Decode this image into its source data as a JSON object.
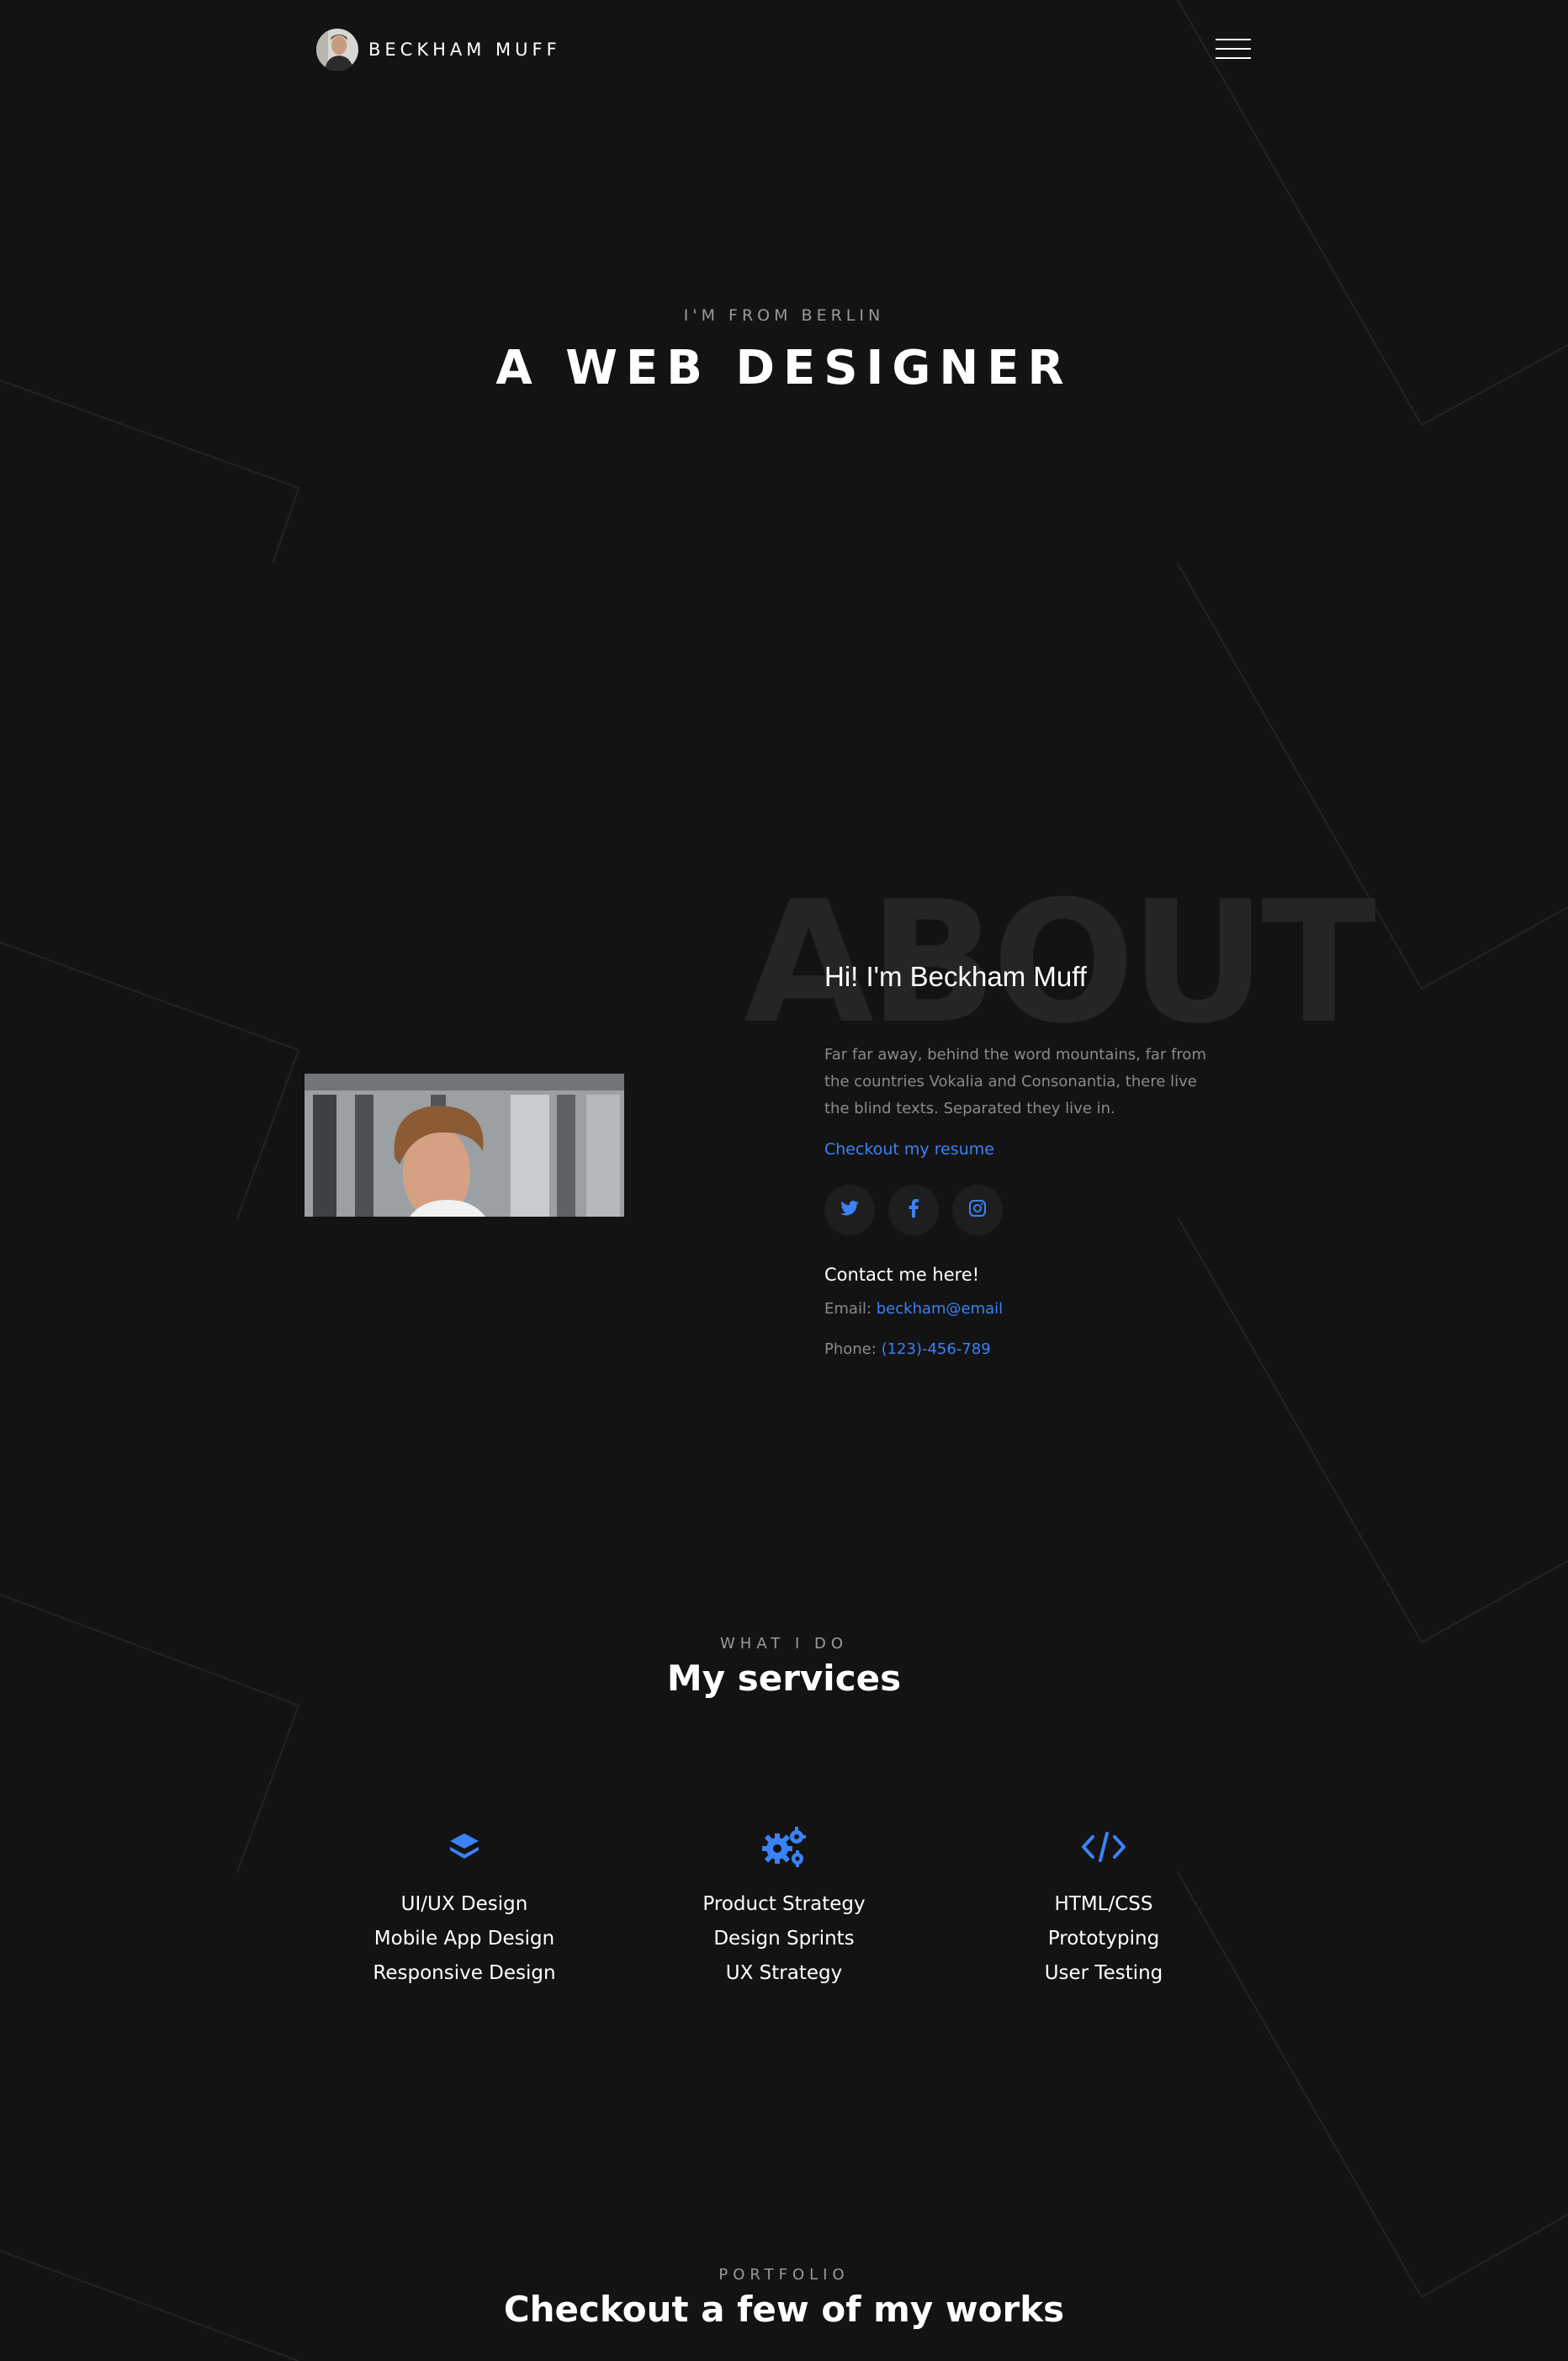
{
  "colors": {
    "background": "#131313",
    "accent": "#3b82f6",
    "muted": "#8a8a8a",
    "watermark": "#252525"
  },
  "header": {
    "brand_name": "BECKHAM MUFF",
    "menu_icon": "hamburger-icon"
  },
  "hero": {
    "subtitle": "I'M FROM BERLIN",
    "title": "A WEB DESIGNER"
  },
  "about": {
    "watermark": "ABOUT",
    "greeting": "Hi! I'm Beckham Muff",
    "text": "Far far away, behind the word mountains, far from the countries Vokalia and Consonantia, there live the blind texts. Separated they live in.",
    "resume_link": "Checkout my resume",
    "socials": [
      {
        "icon": "twitter-icon"
      },
      {
        "icon": "facebook-icon"
      },
      {
        "icon": "instagram-icon"
      }
    ],
    "contact_heading": "Contact me here!",
    "email_label": "Email:",
    "email": "beckham@email",
    "phone_label": "Phone:",
    "phone": "(123)-456-789"
  },
  "services": {
    "subtitle": "WHAT I DO",
    "title": "My services",
    "columns": [
      {
        "icon": "layers-icon",
        "items": [
          "UI/UX Design",
          "Mobile App Design",
          "Responsive Design"
        ]
      },
      {
        "icon": "gears-icon",
        "items": [
          "Product Strategy",
          "Design Sprints",
          "UX Strategy"
        ]
      },
      {
        "icon": "code-icon",
        "items": [
          "HTML/CSS",
          "Prototyping",
          "User Testing"
        ]
      }
    ]
  },
  "portfolio": {
    "subtitle": "PORTFOLIO",
    "title": "Checkout a few of my works"
  }
}
